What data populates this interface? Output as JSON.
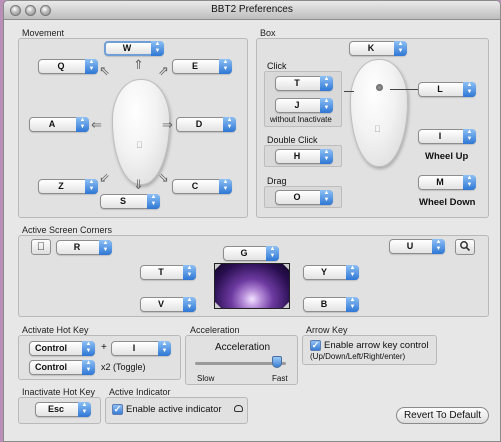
{
  "window": {
    "title": "BBT2 Preferences"
  },
  "movement": {
    "title": "Movement",
    "up": "W",
    "up_left": "Q",
    "up_right": "E",
    "left": "A",
    "right": "D",
    "down_left": "Z",
    "down_right": "C",
    "down": "S"
  },
  "box": {
    "title": "Box",
    "click_label": "Click",
    "click_key": "T",
    "click_alt_key": "J",
    "click_alt_note": "without Inactivate",
    "double_click_label": "Double Click",
    "double_click_key": "H",
    "drag_label": "Drag",
    "drag_key": "O",
    "top_key": "K",
    "right_key": "L",
    "wheel_up_key": "I",
    "wheel_up_label": "Wheel Up",
    "wheel_down_key": "M",
    "wheel_down_label": "Wheel Down"
  },
  "corners": {
    "title": "Active Screen Corners",
    "apple_key": "R",
    "top": "G",
    "top_left": "T",
    "top_right": "Y",
    "bottom_left": "V",
    "bottom_right": "B",
    "search_key": "U"
  },
  "hotkey": {
    "title": "Activate Hot Key",
    "mod1": "Control",
    "plus": "+",
    "key": "I",
    "mod2": "Control",
    "toggle_note": "x2 (Toggle)"
  },
  "accel": {
    "title": "Acceleration",
    "label": "Acceleration",
    "slow": "Slow",
    "fast": "Fast",
    "value": 0.9
  },
  "arrow": {
    "title": "Arrow Key",
    "checkbox_label": "Enable arrow key control",
    "note": "(Up/Down/Left/Right/enter)",
    "checked": true
  },
  "inactivate": {
    "title": "Inactivate Hot Key",
    "key": "Esc"
  },
  "indicator": {
    "title": "Active Indicator",
    "checkbox_label": "Enable active indicator",
    "checked": true
  },
  "footer": {
    "revert_label": "Revert To Default"
  },
  "colors": {
    "accent": "#3a7dd4",
    "window_bg": "#e7e7e7"
  }
}
